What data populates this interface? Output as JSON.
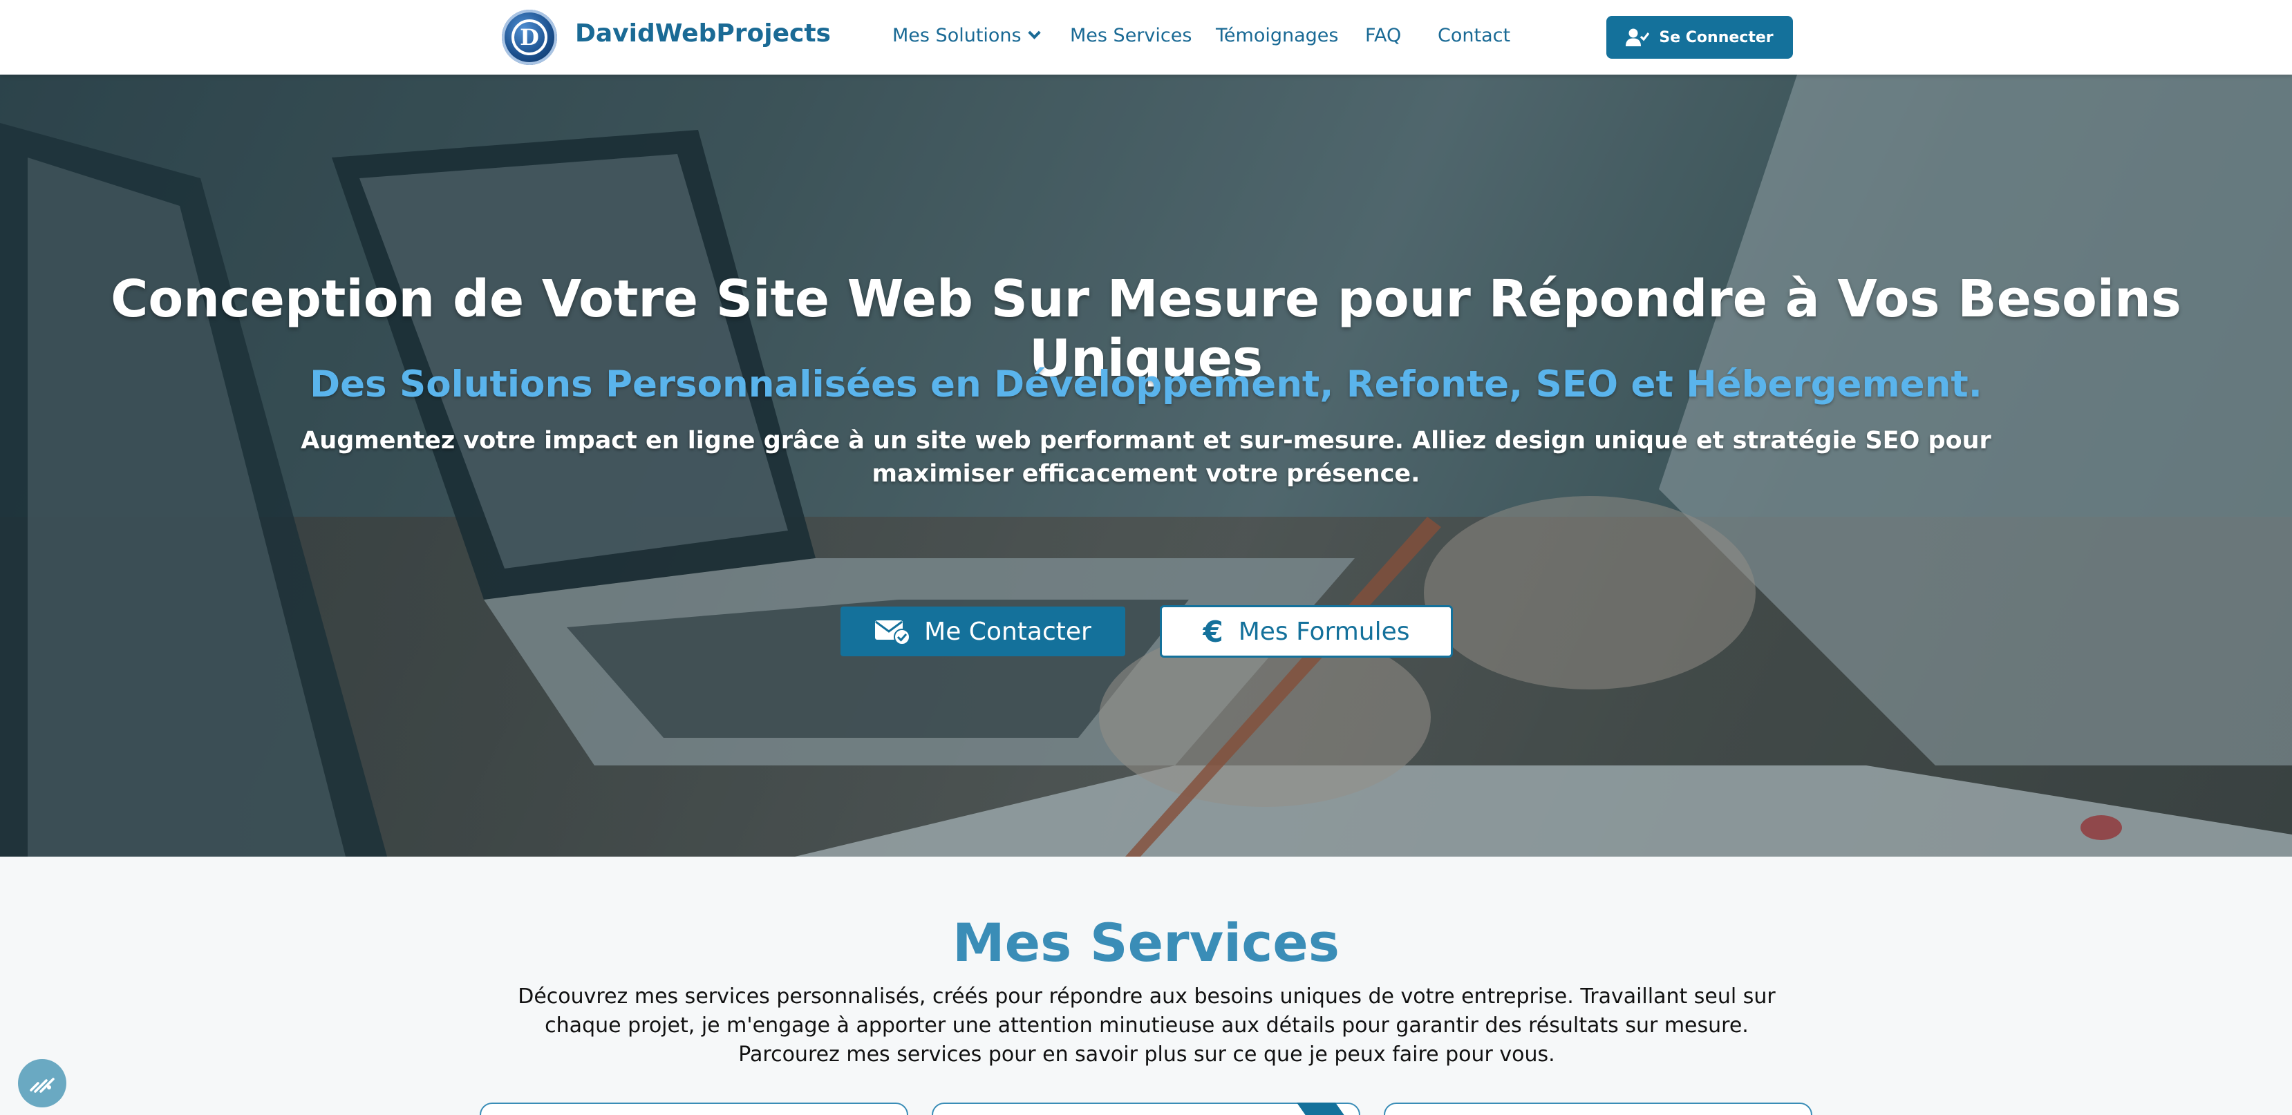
{
  "header": {
    "brand": "DavidWebProjects",
    "logo_letter": "D",
    "nav": [
      {
        "label": "Mes Solutions",
        "has_dropdown": true
      },
      {
        "label": "Mes Services"
      },
      {
        "label": "Témoignages"
      },
      {
        "label": "FAQ"
      },
      {
        "label": "Contact"
      }
    ],
    "login_label": "Se Connecter"
  },
  "hero": {
    "title": "Conception de Votre Site Web Sur Mesure pour Répondre à Vos Besoins Uniques",
    "subtitle": "Des Solutions Personnalisées en Développement, Refonte, SEO et Hébergement.",
    "description": "Augmentez votre impact en ligne grâce à un site web performant et sur-mesure. Alliez design unique et stratégie SEO pour maximiser efficacement votre présence.",
    "contact_button": "Me Contacter",
    "formules_button": "Mes Formules",
    "formules_icon": "€"
  },
  "services": {
    "title": "Mes Services",
    "description": "Découvrez mes services personnalisés, créés pour répondre aux besoins uniques de votre entreprise. Travaillant seul sur chaque projet, je m'engage à apporter une attention minutieuse aux détails pour garantir des résultats sur mesure. Parcourez mes services pour en savoir plus sur ce que je peux faire pour vous."
  },
  "icons": {
    "user-check": "user-check-icon",
    "envelope-check": "envelope-check-icon",
    "accessibility": "accessibility-icon"
  },
  "colors": {
    "primary": "#14719b",
    "brand_text": "#1a6a95",
    "subtitle": "#5ab4ec",
    "services_title": "#3a8db7"
  }
}
